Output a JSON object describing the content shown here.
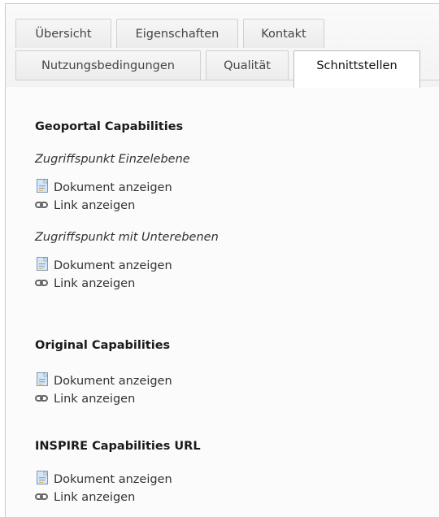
{
  "tabs_row1": [
    {
      "label": "Übersicht"
    },
    {
      "label": "Eigenschaften"
    },
    {
      "label": "Kontakt"
    }
  ],
  "tabs_row2": [
    {
      "label": "Nutzungsbedingungen"
    },
    {
      "label": "Qualität"
    },
    {
      "label": "Schnittstellen",
      "active": true
    }
  ],
  "sections": {
    "geoportal": {
      "title": "Geoportal Capabilities",
      "single": {
        "subtitle": "Zugriffspunkt Einzelebene",
        "doc_label": "Dokument anzeigen",
        "link_label": "Link anzeigen"
      },
      "sub": {
        "subtitle": "Zugriffspunkt mit Unterebenen",
        "doc_label": "Dokument anzeigen",
        "link_label": "Link anzeigen"
      }
    },
    "original": {
      "title": "Original Capabilities",
      "doc_label": "Dokument anzeigen",
      "link_label": "Link anzeigen"
    },
    "inspire": {
      "title": "INSPIRE Capabilities URL",
      "doc_label": "Dokument anzeigen",
      "link_label": "Link anzeigen"
    }
  },
  "icons": {
    "document": "document-icon",
    "link": "link-icon"
  }
}
